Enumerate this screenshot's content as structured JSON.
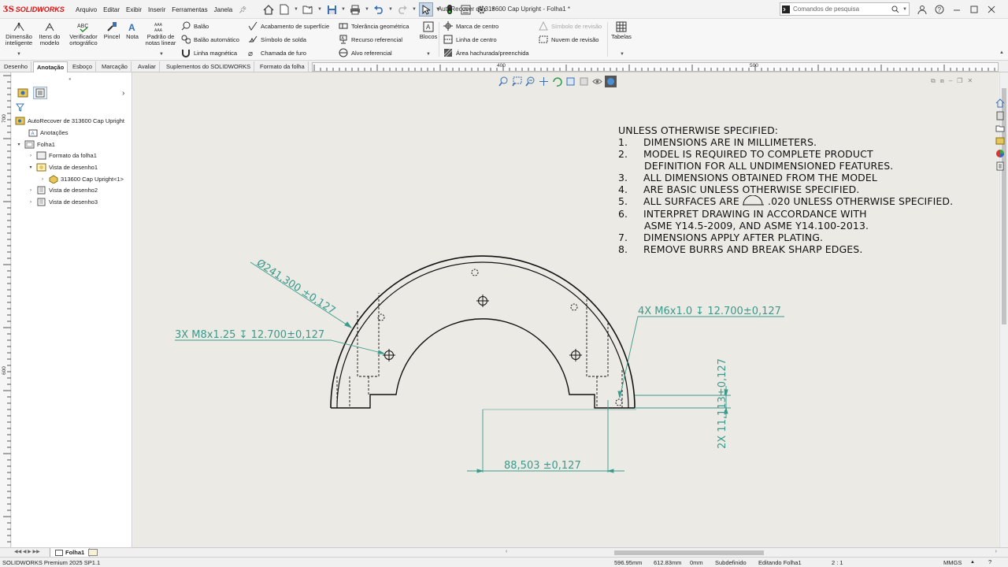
{
  "app": {
    "logo_text": "SOLIDWORKS",
    "document_title": "AutoRecover de 313600 Cap Upright - Folha1 *"
  },
  "menu": [
    "Arquivo",
    "Editar",
    "Exibir",
    "Inserir",
    "Ferramentas",
    "Janela"
  ],
  "search": {
    "placeholder": "Comandos de pesquisa"
  },
  "ribbon": {
    "dimensao_inteligente": "Dimensão inteligente",
    "itens_modelo": "Itens do modelo",
    "verificador_ortografico": "Verificador ortográfico",
    "pincel": "Pincel",
    "nota": "Nota",
    "padrao_notas_linear": "Padrão de notas linear",
    "balao": "Balão",
    "balao_automatico": "Balão automático",
    "linha_magnetica": "Linha magnética",
    "acabamento_superficie": "Acabamento de superfície",
    "simbolo_solda": "Símbolo de solda",
    "chamada_furo": "Chamada de furo",
    "tolerancia_geometrica": "Tolerância geométrica",
    "recurso_referencial": "Recurso referencial",
    "alvo_referencial": "Alvo referencial",
    "blocos": "Blocos",
    "marca_centro": "Marca de centro",
    "linha_centro": "Linha de centro",
    "area_hachurada": "Área hachurada/preenchida",
    "simbolo_revisao": "Símbolo de revisão",
    "nuvem_revisao": "Nuvem de revisão",
    "tabelas": "Tabelas"
  },
  "tabs": [
    "Desenho",
    "Anotação",
    "Esboço",
    "Marcação",
    "Avaliar",
    "Suplementos do SOLIDWORKS",
    "Formato da folha"
  ],
  "active_tab": "Anotação",
  "ruler": {
    "h_labels": [
      "400",
      "500"
    ],
    "v_labels": [
      "700",
      "600"
    ]
  },
  "tree": {
    "root": "AutoRecover de 313600 Cap Upright",
    "anotacoes": "Anotações",
    "folha1": "Folha1",
    "formato_folha": "Formato da folha1",
    "vista1": "Vista de desenho1",
    "part": "313600 Cap Upright<1>",
    "vista2": "Vista de desenho2",
    "vista3": "Vista de desenho3"
  },
  "notes": {
    "header": "UNLESS OTHERWISE SPECIFIED:",
    "items": [
      {
        "num": "1.",
        "text": "DIMENSIONS ARE IN MILLIMETERS."
      },
      {
        "num": "2.",
        "text": "MODEL IS REQUIRED TO COMPLETE PRODUCT"
      },
      {
        "num": "",
        "text": "DEFINITION FOR ALL UNDIMENSIONED FEATURES."
      },
      {
        "num": "3.",
        "text": "ALL DIMENSIONS OBTAINED FROM THE MODEL"
      },
      {
        "num": "4.",
        "text": "ARE BASIC UNLESS OTHERWISE SPECIFIED."
      },
      {
        "num": "5.",
        "text_a": "ALL SURFACES ARE",
        "text_b": ".020 UNLESS OTHERWISE SPECIFIED."
      },
      {
        "num": "6.",
        "text": "INTERPRET DRAWING IN ACCORDANCE WITH"
      },
      {
        "num": "",
        "text": "ASME Y14.5-2009, AND ASME Y14.100-2013."
      },
      {
        "num": "7.",
        "text": "DIMENSIONS APPLY AFTER PLATING."
      },
      {
        "num": "8.",
        "text": "REMOVE BURRS AND BREAK SHARP EDGES."
      }
    ]
  },
  "dimensions": {
    "diameter": "Ø241,300 ±0,127",
    "hole_m8": "3X M8x1.25 ↧ 12.700±0,127",
    "hole_m6": "4X M6x1.0 ↧ 12.700±0,127",
    "vertical": "2X 11,113±0,127",
    "horizontal": "88,503 ±0,127"
  },
  "colors": {
    "dimension": "#3a9a8c",
    "canvas_bg": "#ebeae4",
    "logo_red": "#d11111"
  },
  "sheet_tab": "Folha1",
  "status": {
    "product": "SOLIDWORKS Premium 2025 SP1.1",
    "x": "596.95mm",
    "y": "612.83mm",
    "z": "0mm",
    "state": "Subdefinido",
    "editing": "Editando Folha1",
    "scale": "2 : 1",
    "units": "MMGS"
  }
}
